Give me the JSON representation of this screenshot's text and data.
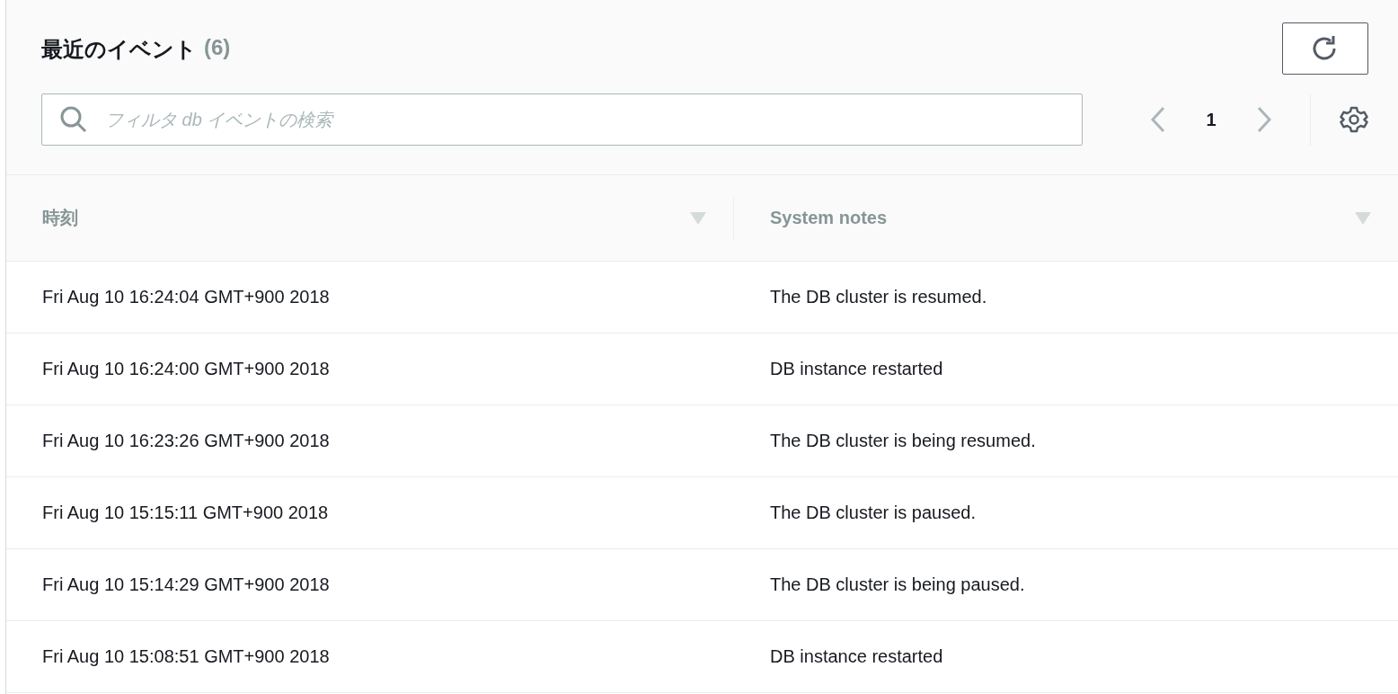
{
  "panel": {
    "title": "最近のイベント",
    "count": "(6)"
  },
  "search": {
    "placeholder": "フィルタ db イベントの検索"
  },
  "pagination": {
    "page": "1",
    "prev_disabled": true,
    "next_disabled": true
  },
  "table": {
    "columns": [
      {
        "label": "時刻"
      },
      {
        "label": "System notes"
      }
    ],
    "rows": [
      {
        "time": "Fri Aug 10 16:24:04 GMT+900 2018",
        "note": "The DB cluster is resumed."
      },
      {
        "time": "Fri Aug 10 16:24:00 GMT+900 2018",
        "note": "DB instance restarted"
      },
      {
        "time": "Fri Aug 10 16:23:26 GMT+900 2018",
        "note": "The DB cluster is being resumed."
      },
      {
        "time": "Fri Aug 10 15:15:11 GMT+900 2018",
        "note": "The DB cluster is paused."
      },
      {
        "time": "Fri Aug 10 15:14:29 GMT+900 2018",
        "note": "The DB cluster is being paused."
      },
      {
        "time": "Fri Aug 10 15:08:51 GMT+900 2018",
        "note": "DB instance restarted"
      }
    ]
  }
}
